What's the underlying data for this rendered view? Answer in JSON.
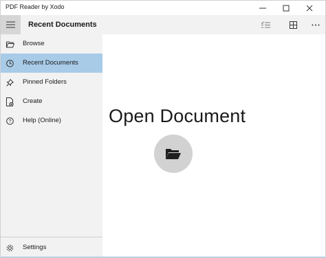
{
  "window": {
    "title": "PDF Reader by Xodo",
    "controls": [
      "minimize-icon",
      "maximize-icon",
      "close-icon"
    ]
  },
  "header": {
    "menu_icon": "hamburger-icon",
    "title": "Recent Documents",
    "actions": [
      "list-select-icon",
      "grid-view-icon",
      "more-icon"
    ]
  },
  "sidebar": {
    "items": [
      {
        "label": "Browse",
        "icon": "folder-open-icon",
        "active": false
      },
      {
        "label": "Recent Documents",
        "icon": "clock-icon",
        "active": true
      },
      {
        "label": "Pinned Folders",
        "icon": "pin-icon",
        "active": false
      },
      {
        "label": "Create",
        "icon": "create-document-icon",
        "active": false
      },
      {
        "label": "Help (Online)",
        "icon": "help-icon",
        "active": false
      }
    ],
    "settings": {
      "label": "Settings",
      "icon": "gear-icon"
    }
  },
  "main": {
    "title": "Open Document",
    "open_button_icon": "folder-open-icon"
  },
  "colors": {
    "active_item": "#a8cbe8",
    "sidebar_bg": "#f2f2f2",
    "hamburger_bg": "#d6d6d6",
    "open_button_bg": "#d2d2d2"
  }
}
